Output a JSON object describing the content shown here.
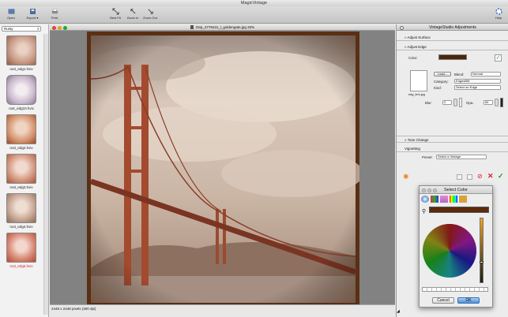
{
  "app": {
    "title": "MagicVintage"
  },
  "toolbar": {
    "open": "Open",
    "export": "Export",
    "print": "Print",
    "best_fit": "Best Fit",
    "zoom_in": "Zoom In",
    "zoom_out": "Zoom Out",
    "help": "Help"
  },
  "left_panel": {
    "preset": "Rusty",
    "items": [
      {
        "label": "rust_edg1.hviv",
        "active": false
      },
      {
        "label": "rust_edg10.hviv",
        "active": false
      },
      {
        "label": "rust_edg2.hviv",
        "active": false
      },
      {
        "label": "rust_edg3.hviv",
        "active": false
      },
      {
        "label": "rust_edg4.hviv",
        "active": false
      },
      {
        "label": "rust_edg5.hviv",
        "active": true
      }
    ]
  },
  "document": {
    "title": "Dep_2778431_l_goldengate.jpg 33%",
    "status": "2448 x 2448 pixels (300 dpi)"
  },
  "right_panel": {
    "title": "VintageStudio Adjustments",
    "adjust_surface": "Adjust Surface",
    "adjust_edge": "Adjust Edge",
    "color_label": "Color:",
    "edge_color": "#4d2508",
    "load_button": "Load...",
    "blend_label": "Blend:",
    "blend_value": "Normal",
    "category_label": "Category:",
    "category_value": "EdgesBM",
    "kind_label": "Kind:",
    "kind_value": "Select an Edge",
    "edge_file": "edg_tem.jpg",
    "blur_label": "Blur:",
    "blur_value": "0",
    "opacity_label": "Opa..",
    "opacity_value": "84",
    "tone_change": "Tone Change",
    "vignetting": "Vignetting",
    "preset_label": "Preset:",
    "preset_value": "Select a Vintage"
  },
  "color_picker": {
    "title": "Select Color",
    "current_color": "#5b2a0a",
    "cancel": "Cancel",
    "ok": "OK"
  }
}
